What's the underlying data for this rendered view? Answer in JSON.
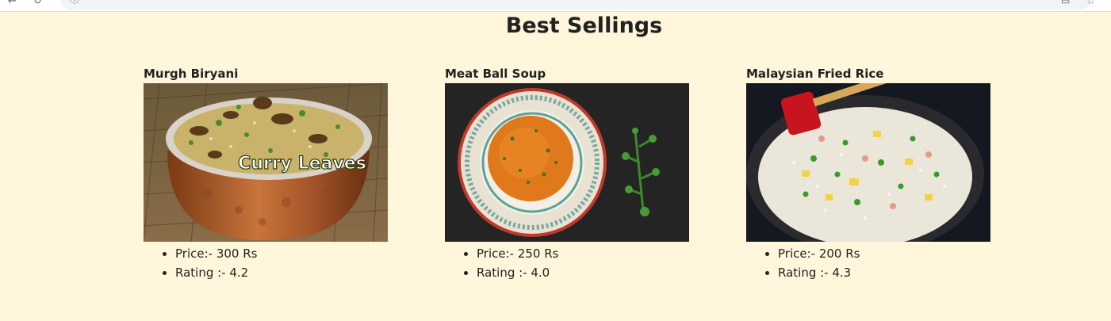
{
  "page": {
    "title": "Best Sellings"
  },
  "items": [
    {
      "name": "Murgh Biryani",
      "price": "Price:- 300 Rs",
      "rating": "Rating :- 4.2",
      "photo_caption": "Curry Leaves"
    },
    {
      "name": "Meat Ball Soup",
      "price": "Price:- 250 Rs",
      "rating": "Rating :- 4.0"
    },
    {
      "name": "Malaysian Fried Rice",
      "price": "Price:- 200 Rs",
      "rating": "Rating :- 4.3"
    }
  ],
  "colors": {
    "page_background": "#fff6dc",
    "text": "#222222"
  }
}
